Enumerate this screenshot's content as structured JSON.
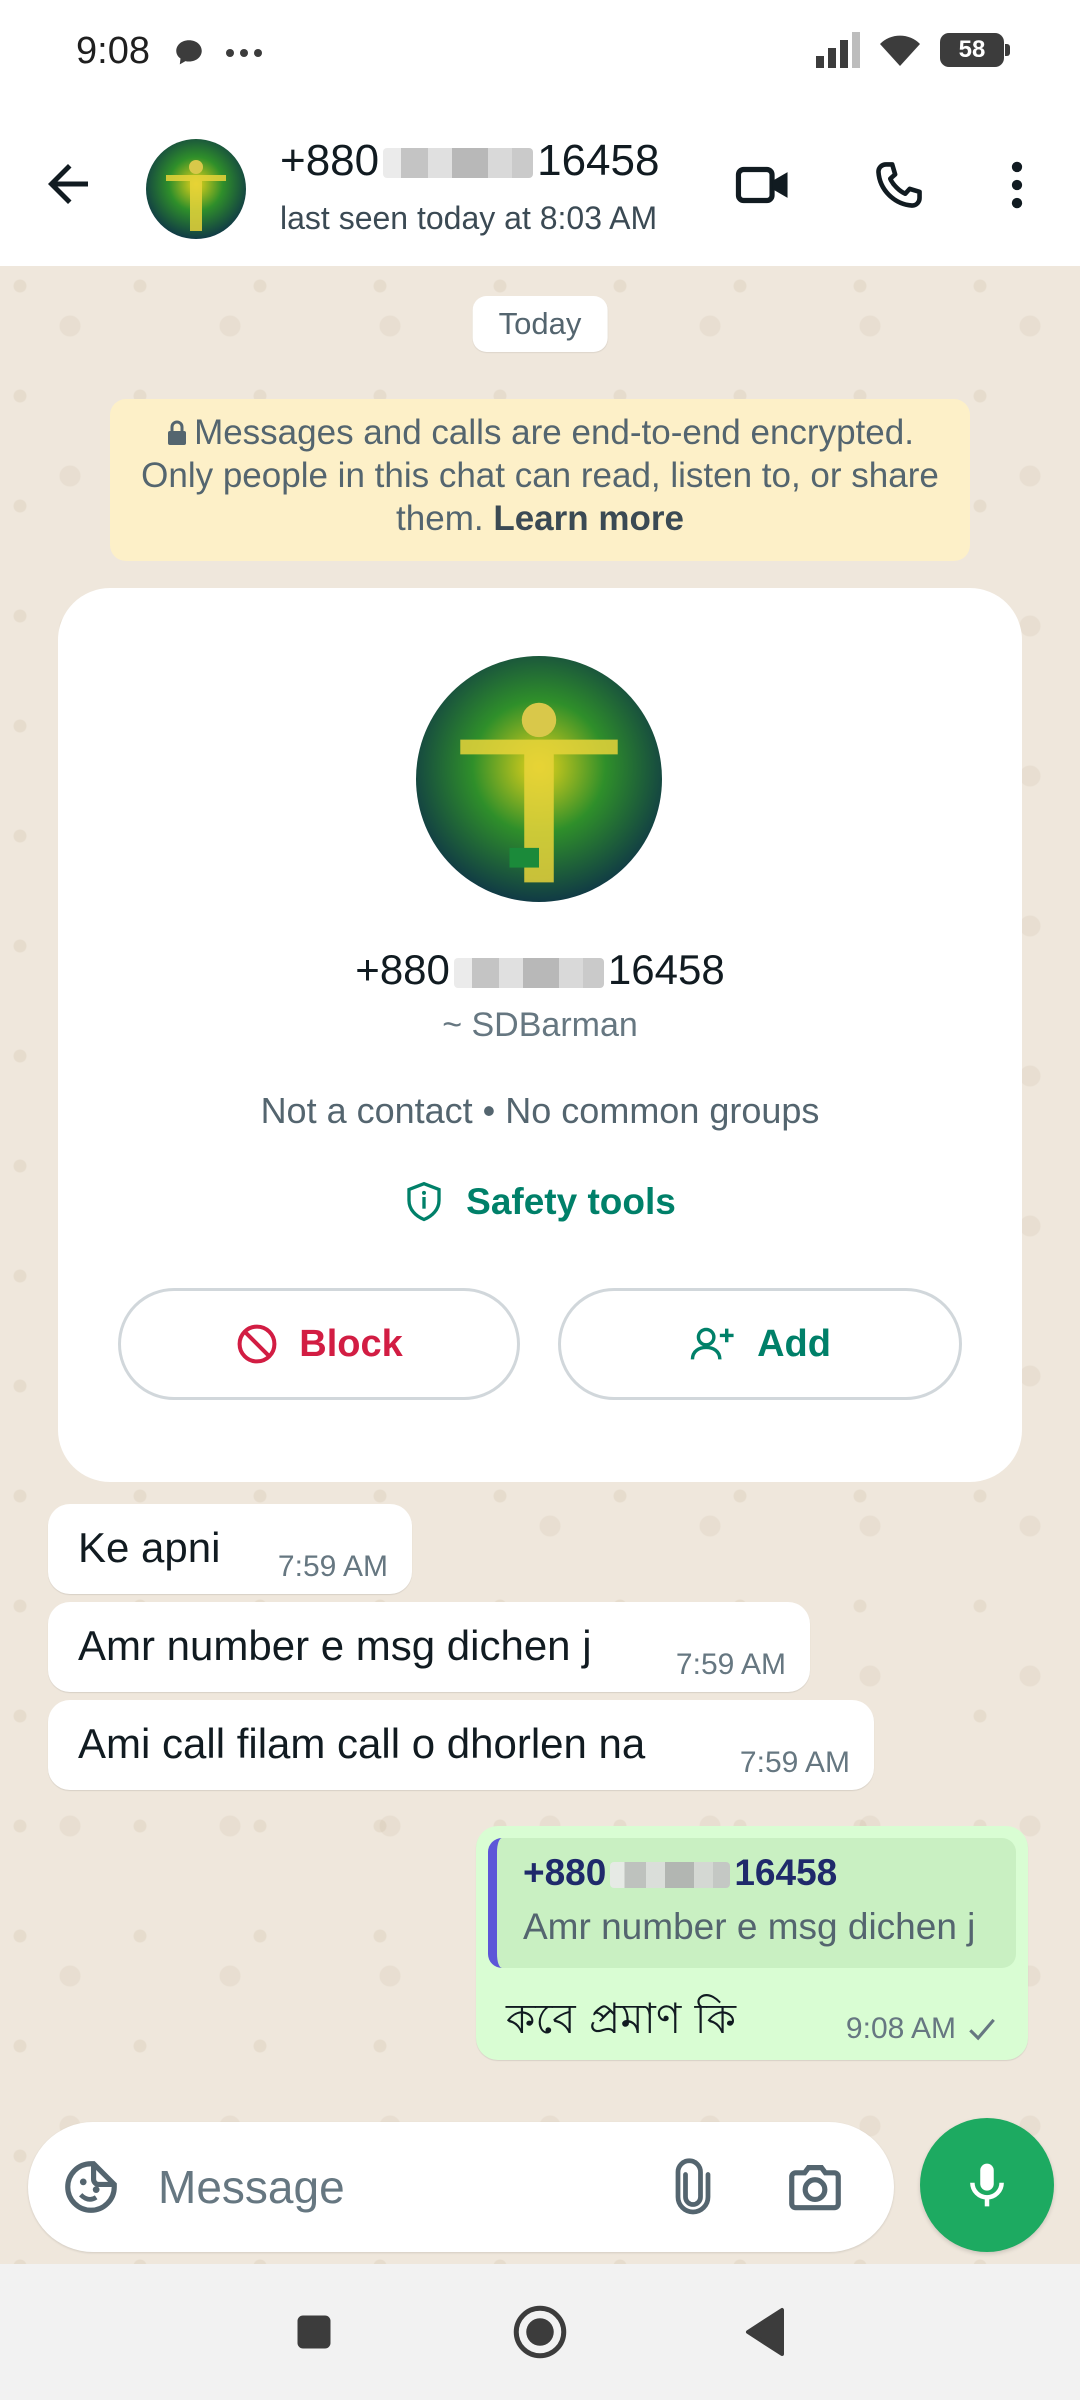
{
  "status_bar": {
    "time": "9:08",
    "battery": "58"
  },
  "header": {
    "name_prefix": "+880",
    "name_suffix": "16458",
    "status": "last seen today at 8:03 AM"
  },
  "chat": {
    "date_chip": "Today",
    "encryption": {
      "text": "Messages and calls are end-to-end encrypted. Only people in this chat can read, listen to, or share them.",
      "link": "Learn more"
    },
    "profile_card": {
      "name_prefix": "+880",
      "name_suffix": "16458",
      "push_name": "~ SDBarman",
      "info": "Not a contact • No common groups",
      "safety_label": "Safety tools",
      "block_label": "Block",
      "add_label": "Add"
    },
    "incoming": [
      {
        "text": "Ke apni",
        "time": "7:59 AM"
      },
      {
        "text": "Amr number e msg dichen j",
        "time": "7:59 AM"
      },
      {
        "text": "Ami call filam call o dhorlen na",
        "time": "7:59 AM"
      }
    ],
    "outgoing": {
      "quote_name_prefix": "+880",
      "quote_name_suffix": "16458",
      "quote_text": "Amr number e msg dichen j",
      "text": "কবে প্রমাণ কি",
      "time": "9:08 AM"
    }
  },
  "composer": {
    "placeholder": "Message"
  },
  "colors": {
    "accent": "#008069",
    "block": "#d21d43",
    "mic": "#1daa61",
    "outgoing_bubble": "#d9fdd3",
    "encryption_bg": "#fdf0c8"
  }
}
